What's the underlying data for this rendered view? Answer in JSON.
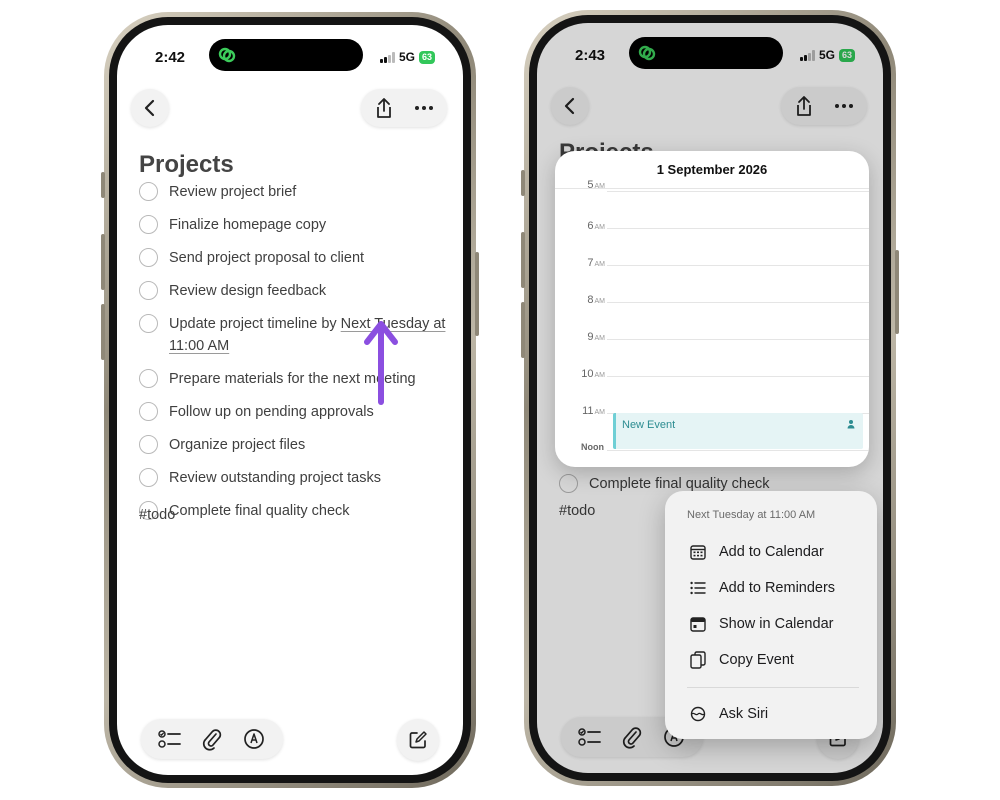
{
  "left_phone": {
    "status": {
      "time": "2:42",
      "network": "5G",
      "battery": "63"
    },
    "note": {
      "title": "Projects",
      "items": [
        "Review project brief",
        "Finalize homepage copy",
        "Send project proposal to client",
        "Review design feedback",
        {
          "before": "Update project timeline by ",
          "link": "Next Tuesday at 11:00 AM"
        },
        "Prepare materials for the next meeting",
        "Follow up on pending approvals",
        "Organize project files",
        "Review outstanding project tasks",
        "Complete final quality check"
      ],
      "tag": "#todo"
    }
  },
  "right_phone": {
    "status": {
      "time": "2:43",
      "network": "5G",
      "battery": "63"
    },
    "note": {
      "title": "Projects",
      "visible_item": "Complete final quality check",
      "tag": "#todo"
    },
    "calendar": {
      "date": "1 September 2026",
      "hours": [
        {
          "num": "5",
          "ampm": "AM"
        },
        {
          "num": "6",
          "ampm": "AM"
        },
        {
          "num": "7",
          "ampm": "AM"
        },
        {
          "num": "8",
          "ampm": "AM"
        },
        {
          "num": "9",
          "ampm": "AM"
        },
        {
          "num": "10",
          "ampm": "AM"
        },
        {
          "num": "11",
          "ampm": "AM"
        },
        {
          "num": "Noon",
          "ampm": ""
        }
      ],
      "event_title": "New Event"
    },
    "menu": {
      "heading": "Next Tuesday at 11:00 AM",
      "items": [
        {
          "label": "Add to Calendar",
          "icon": "calendar-grid-icon"
        },
        {
          "label": "Add to Reminders",
          "icon": "list-icon"
        },
        {
          "label": "Show in Calendar",
          "icon": "calendar-icon"
        },
        {
          "label": "Copy Event",
          "icon": "copy-icon"
        },
        {
          "label": "Ask Siri",
          "icon": "siri-icon"
        }
      ]
    }
  },
  "colors": {
    "accent_arrow": "#8b4fe0",
    "event_fill": "#e5f4f5",
    "event_bar": "#6fcfd5",
    "battery": "#32c75a"
  }
}
